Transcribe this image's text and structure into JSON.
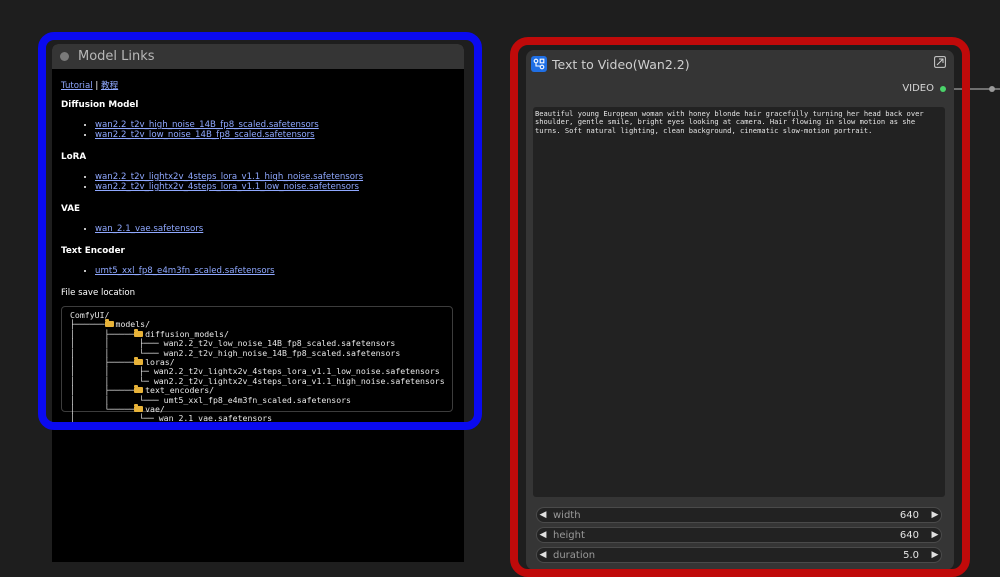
{
  "model_links": {
    "title": "Model Links",
    "tutorial_link": "Tutorial",
    "separator": "|",
    "tutorial_cn_link": "教程",
    "sections": [
      {
        "heading": "Diffusion Model",
        "links": [
          "wan2.2_t2v_high_noise_14B_fp8_scaled.safetensors",
          "wan2.2_t2v_low_noise_14B_fp8_scaled.safetensors"
        ]
      },
      {
        "heading": "LoRA",
        "links": [
          "wan2.2_t2v_lightx2v_4steps_lora_v1.1_high_noise.safetensors",
          "wan2.2_t2v_lightx2v_4steps_lora_v1.1_low_noise.safetensors"
        ]
      },
      {
        "heading": "VAE",
        "links": [
          "wan_2.1_vae.safetensors"
        ]
      },
      {
        "heading": "Text Encoder",
        "links": [
          "umt5_xxl_fp8_e4m3fn_scaled.safetensors"
        ]
      }
    ],
    "file_save_location": "File save location",
    "tree": {
      "root": "ComfyUI/",
      "models": "models/",
      "diffusion_models": "diffusion_models/",
      "dm_1": "wan2.2_t2v_low_noise_14B_fp8_scaled.safetensors",
      "dm_2": "wan2.2_t2v_high_noise_14B_fp8_scaled.safetensors",
      "loras": "loras/",
      "lora_1": "wan2.2_t2v_lightx2v_4steps_lora_v1.1_low_noise.safetensors",
      "lora_2": "wan2.2_t2v_lightx2v_4steps_lora_v1.1_high_noise.safetensors",
      "text_encoders": "text_encoders/",
      "te_1": "umt5_xxl_fp8_e4m3fn_scaled.safetensors",
      "vae": "vae/",
      "vae_1": "wan_2.1_vae.safetensors"
    }
  },
  "text_to_video": {
    "title": "Text to Video(Wan2.2)",
    "output_label": "VIDEO",
    "prompt": "Beautiful young European woman with honey blonde hair gracefully turning her head back over shoulder, gentle smile, bright eyes looking at camera. Hair flowing in slow motion as she turns. Soft natural lighting, clean background, cinematic slow-motion portrait.",
    "widgets": [
      {
        "label": "width",
        "value": "640"
      },
      {
        "label": "height",
        "value": "640"
      },
      {
        "label": "duration",
        "value": "5.0"
      }
    ]
  },
  "colors": {
    "highlight_left": "#0a0af0",
    "highlight_right": "#c00a0a",
    "output_dot": "#4ad36a",
    "link": "#8fa8ff"
  }
}
